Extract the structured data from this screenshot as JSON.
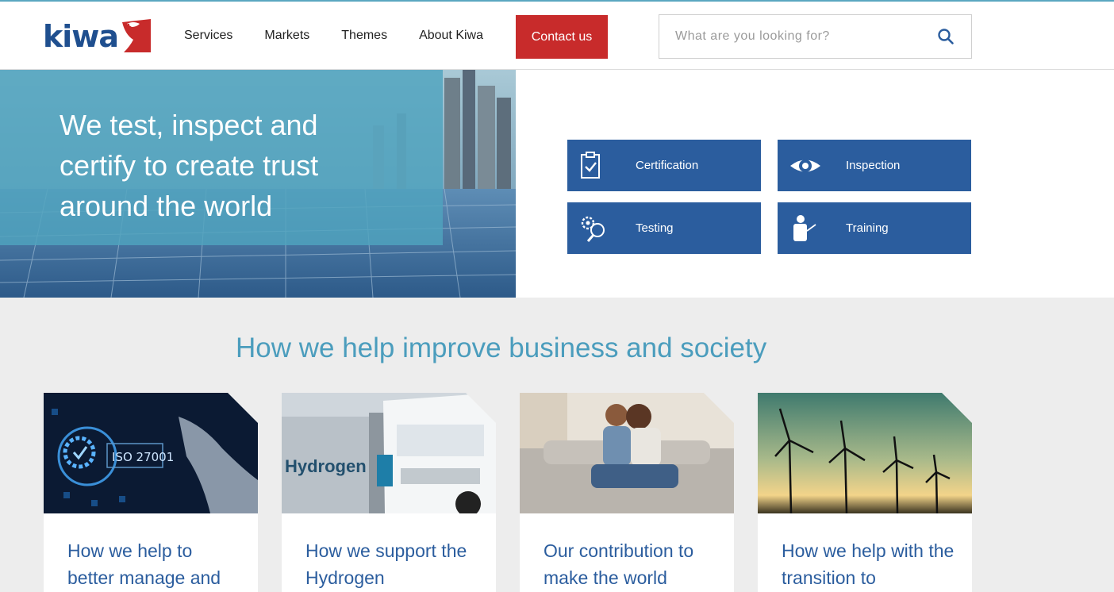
{
  "brand": {
    "logo_text": "kiwa",
    "accent": "#c82b2b",
    "primary": "#2b5d9e",
    "teal": "#4b9dbd"
  },
  "nav": {
    "items": [
      {
        "label": "Services"
      },
      {
        "label": "Markets"
      },
      {
        "label": "Themes"
      },
      {
        "label": "About Kiwa"
      }
    ],
    "contact_label": "Contact us"
  },
  "search": {
    "placeholder": "What are you looking for?",
    "icon": "search-icon"
  },
  "hero": {
    "title": "We test, inspect and certify to create trust around the world"
  },
  "services": [
    {
      "label": "Certification",
      "icon": "clipboard-check-icon"
    },
    {
      "label": "Inspection",
      "icon": "eye-icon"
    },
    {
      "label": "Testing",
      "icon": "gears-magnifier-icon"
    },
    {
      "label": "Training",
      "icon": "trainer-icon"
    }
  ],
  "section": {
    "title": "How we help improve business and society"
  },
  "cards": [
    {
      "title": "How we help to better manage and",
      "image": "iso-27001-image",
      "image_text": "ISO 27001"
    },
    {
      "title": "How we support the Hydrogen",
      "image": "hydrogen-truck-image",
      "image_text": "Hydrogen"
    },
    {
      "title": "Our contribution to make the world",
      "image": "couple-sofa-image"
    },
    {
      "title": "How we help with the transition to",
      "image": "wind-turbines-image"
    }
  ]
}
